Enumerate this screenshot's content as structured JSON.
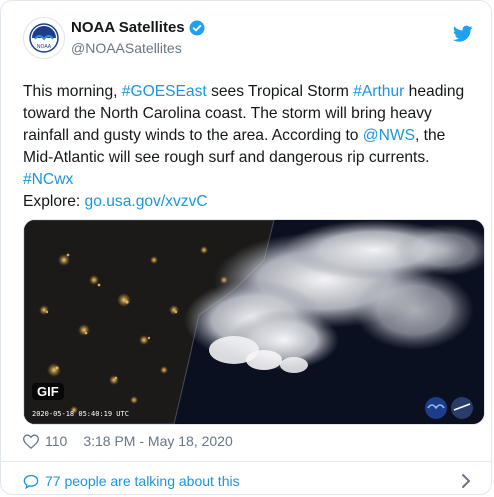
{
  "author": {
    "display_name": "NOAA Satellites",
    "handle": "@NOAASatellites",
    "avatar_icon": "noaa-logo-icon",
    "verified_icon": "verified-badge-icon"
  },
  "brand_icon": "twitter-bird-icon",
  "tweet": {
    "seg1": "This morning, ",
    "tag_goes": "#GOESEast",
    "seg2": " sees Tropical Storm ",
    "tag_arthur": "#Arthur",
    "seg3": " heading toward the North Carolina coast. The storm will bring heavy rainfall and gusty winds to the area. According to ",
    "mention_nws": "@NWS",
    "seg4": ", the Mid-Atlantic will see rough surf and dangerous rip currents.",
    "tag_ncwx": "#NCwx",
    "explore_label": "Explore: ",
    "explore_link": "go.usa.gov/xvzvC"
  },
  "media": {
    "badge": "GIF",
    "timestamp": "2020-05-18 05:40:19 UTC"
  },
  "footer": {
    "like_count": "110",
    "datetime": "3:18 PM - May 18, 2020",
    "talking": "77 people are talking about this"
  },
  "colors": {
    "link": "#1b95e0",
    "text": "#14171a",
    "muted": "#657786"
  }
}
